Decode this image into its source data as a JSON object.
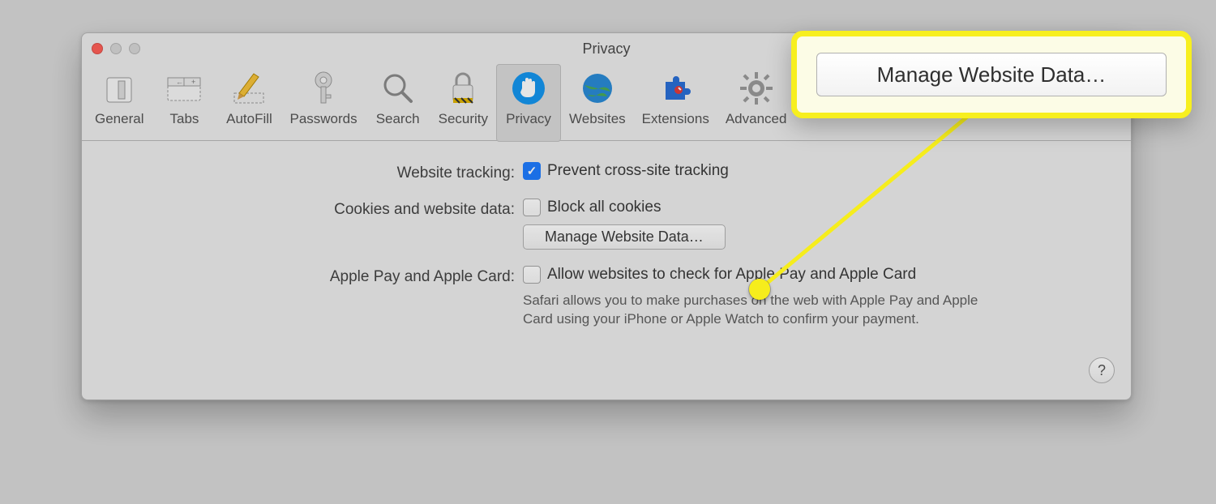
{
  "window": {
    "title": "Privacy"
  },
  "toolbar": {
    "general": "General",
    "tabs": "Tabs",
    "autofill": "AutoFill",
    "passwords": "Passwords",
    "search": "Search",
    "security": "Security",
    "privacy": "Privacy",
    "websites": "Websites",
    "extensions": "Extensions",
    "advanced": "Advanced"
  },
  "section_tracking": {
    "label": "Website tracking:",
    "option": "Prevent cross-site tracking",
    "checked": true
  },
  "section_cookies": {
    "label": "Cookies and website data:",
    "option": "Block all cookies",
    "checked": false,
    "button": "Manage Website Data…"
  },
  "section_applepay": {
    "label": "Apple Pay and Apple Card:",
    "option": "Allow websites to check for Apple Pay and Apple Card",
    "checked": false,
    "description": "Safari allows you to make purchases on the web with Apple Pay and Apple Card using your iPhone or Apple Watch to confirm your payment."
  },
  "help": "?",
  "callout": {
    "button": "Manage Website Data…"
  }
}
